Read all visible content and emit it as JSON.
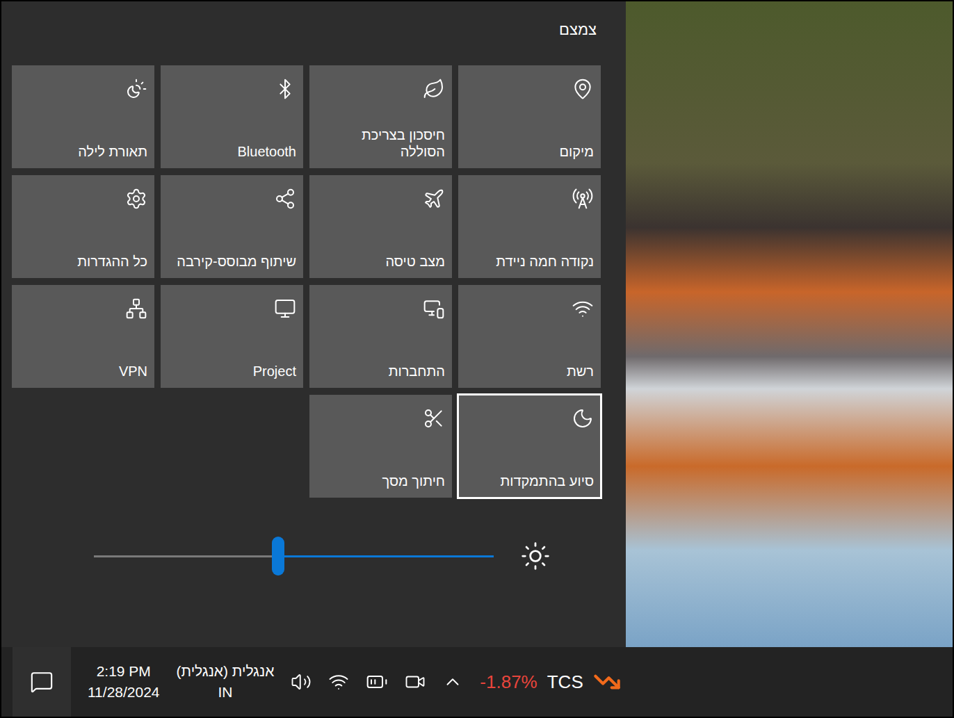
{
  "header": {
    "collapse": "צמצם"
  },
  "tiles": [
    {
      "label": "מיקום",
      "selected": false
    },
    {
      "label": "חיסכון בצריכת הסוללה",
      "selected": false
    },
    {
      "label": "Bluetooth",
      "selected": false
    },
    {
      "label": "תאורת לילה",
      "selected": false
    },
    {
      "label": "נקודה חמה ניידת",
      "selected": false
    },
    {
      "label": "מצב טיסה",
      "selected": false
    },
    {
      "label": "שיתוף מבוסס-קירבה",
      "selected": false
    },
    {
      "label": "כל ההגדרות",
      "selected": false
    },
    {
      "label": "רשת",
      "selected": false
    },
    {
      "label": "התחברות",
      "selected": false
    },
    {
      "label": "Project",
      "selected": false
    },
    {
      "label": "VPN",
      "selected": false
    },
    {
      "label": "סיוע בהתמקדות",
      "selected": true
    },
    {
      "label": "חיתוך מסך",
      "selected": false
    }
  ],
  "brightness": {
    "level": 0.54
  },
  "taskbar": {
    "stock": {
      "symbol": "TCS",
      "change": "-1.87%"
    },
    "language": "אנגלית (אנגלית)",
    "locale": "IN",
    "time": "2:19 PM",
    "date": "11/28/2024"
  }
}
